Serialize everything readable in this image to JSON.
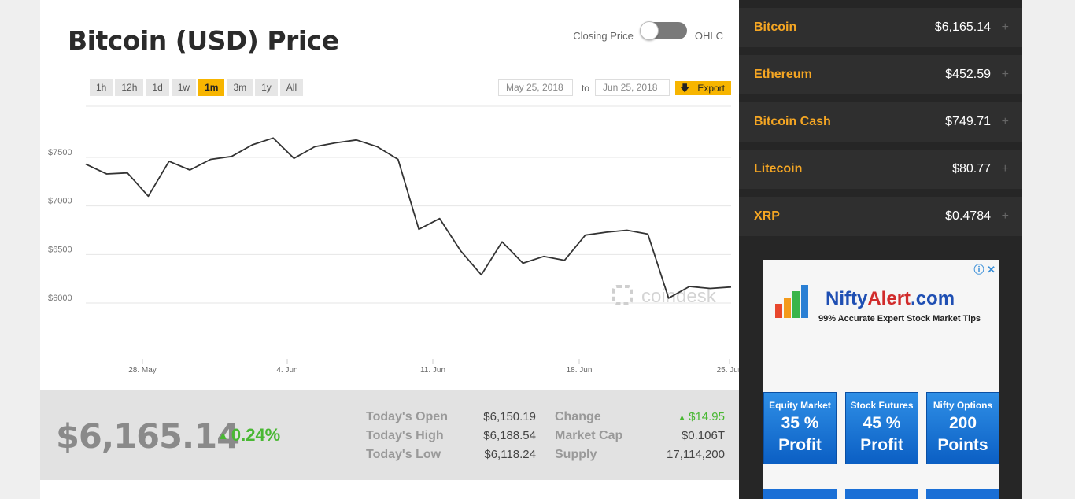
{
  "header": {
    "title": "Bitcoin (USD) Price",
    "toggle_left": "Closing Price",
    "toggle_right": "OHLC"
  },
  "ranges": [
    {
      "label": "1h",
      "active": false
    },
    {
      "label": "12h",
      "active": false
    },
    {
      "label": "1d",
      "active": false
    },
    {
      "label": "1w",
      "active": false
    },
    {
      "label": "1m",
      "active": true
    },
    {
      "label": "3m",
      "active": false
    },
    {
      "label": "1y",
      "active": false
    },
    {
      "label": "All",
      "active": false
    }
  ],
  "dates": {
    "from": "May 25, 2018",
    "to_label": "to",
    "to": "Jun 25, 2018",
    "export_label": "Export"
  },
  "chart_data": {
    "type": "line",
    "watermark": "coindesk",
    "y_ticks": [
      "$7500",
      "$7000",
      "$6500",
      "$6000"
    ],
    "y_tick_values": [
      7500,
      7000,
      6500,
      6000
    ],
    "x_ticks": [
      "28. May",
      "4. Jun",
      "11. Jun",
      "18. Jun",
      "25. Jun"
    ],
    "ylim": [
      5500,
      8000
    ],
    "series": [
      {
        "values": [
          7430,
          7330,
          7340,
          7100,
          7460,
          7370,
          7480,
          7510,
          7630,
          7700,
          7490,
          7610,
          7650,
          7680,
          7610,
          7480,
          6760,
          6870,
          6540,
          6290,
          6630,
          6410,
          6480,
          6440,
          6700,
          6730,
          6750,
          6710,
          6050,
          6170,
          6150,
          6165
        ]
      }
    ]
  },
  "stats": {
    "price": "$6,165.14",
    "change_pct": "0.24%",
    "open_label": "Today's Open",
    "open": "$6,150.19",
    "high_label": "Today's High",
    "high": "$6,188.54",
    "low_label": "Today's Low",
    "low": "$6,118.24",
    "change_label": "Change",
    "change": "$14.95",
    "mcap_label": "Market Cap",
    "mcap": "$0.106T",
    "supply_label": "Supply",
    "supply": "17,114,200",
    "up_color": "#49b833"
  },
  "sidebar": {
    "coins": [
      {
        "name": "Bitcoin",
        "price": "$6,165.14"
      },
      {
        "name": "Ethereum",
        "price": "$452.59"
      },
      {
        "name": "Bitcoin Cash",
        "price": "$749.71"
      },
      {
        "name": "Litecoin",
        "price": "$80.77"
      },
      {
        "name": "XRP",
        "price": "$0.4784"
      }
    ],
    "accent": "#f5a623"
  },
  "ad": {
    "brand_a": "Nifty",
    "brand_b": "Alert",
    "brand_c": ".com",
    "tagline": "99% Accurate Expert Stock Market Tips",
    "tiles": [
      {
        "title": "Equity Market",
        "line1": "35 %",
        "line2": "Profit"
      },
      {
        "title": "Stock Futures",
        "line1": "45 %",
        "line2": "Profit"
      },
      {
        "title": "Nifty Options",
        "line1": "200",
        "line2": "Points"
      }
    ]
  }
}
